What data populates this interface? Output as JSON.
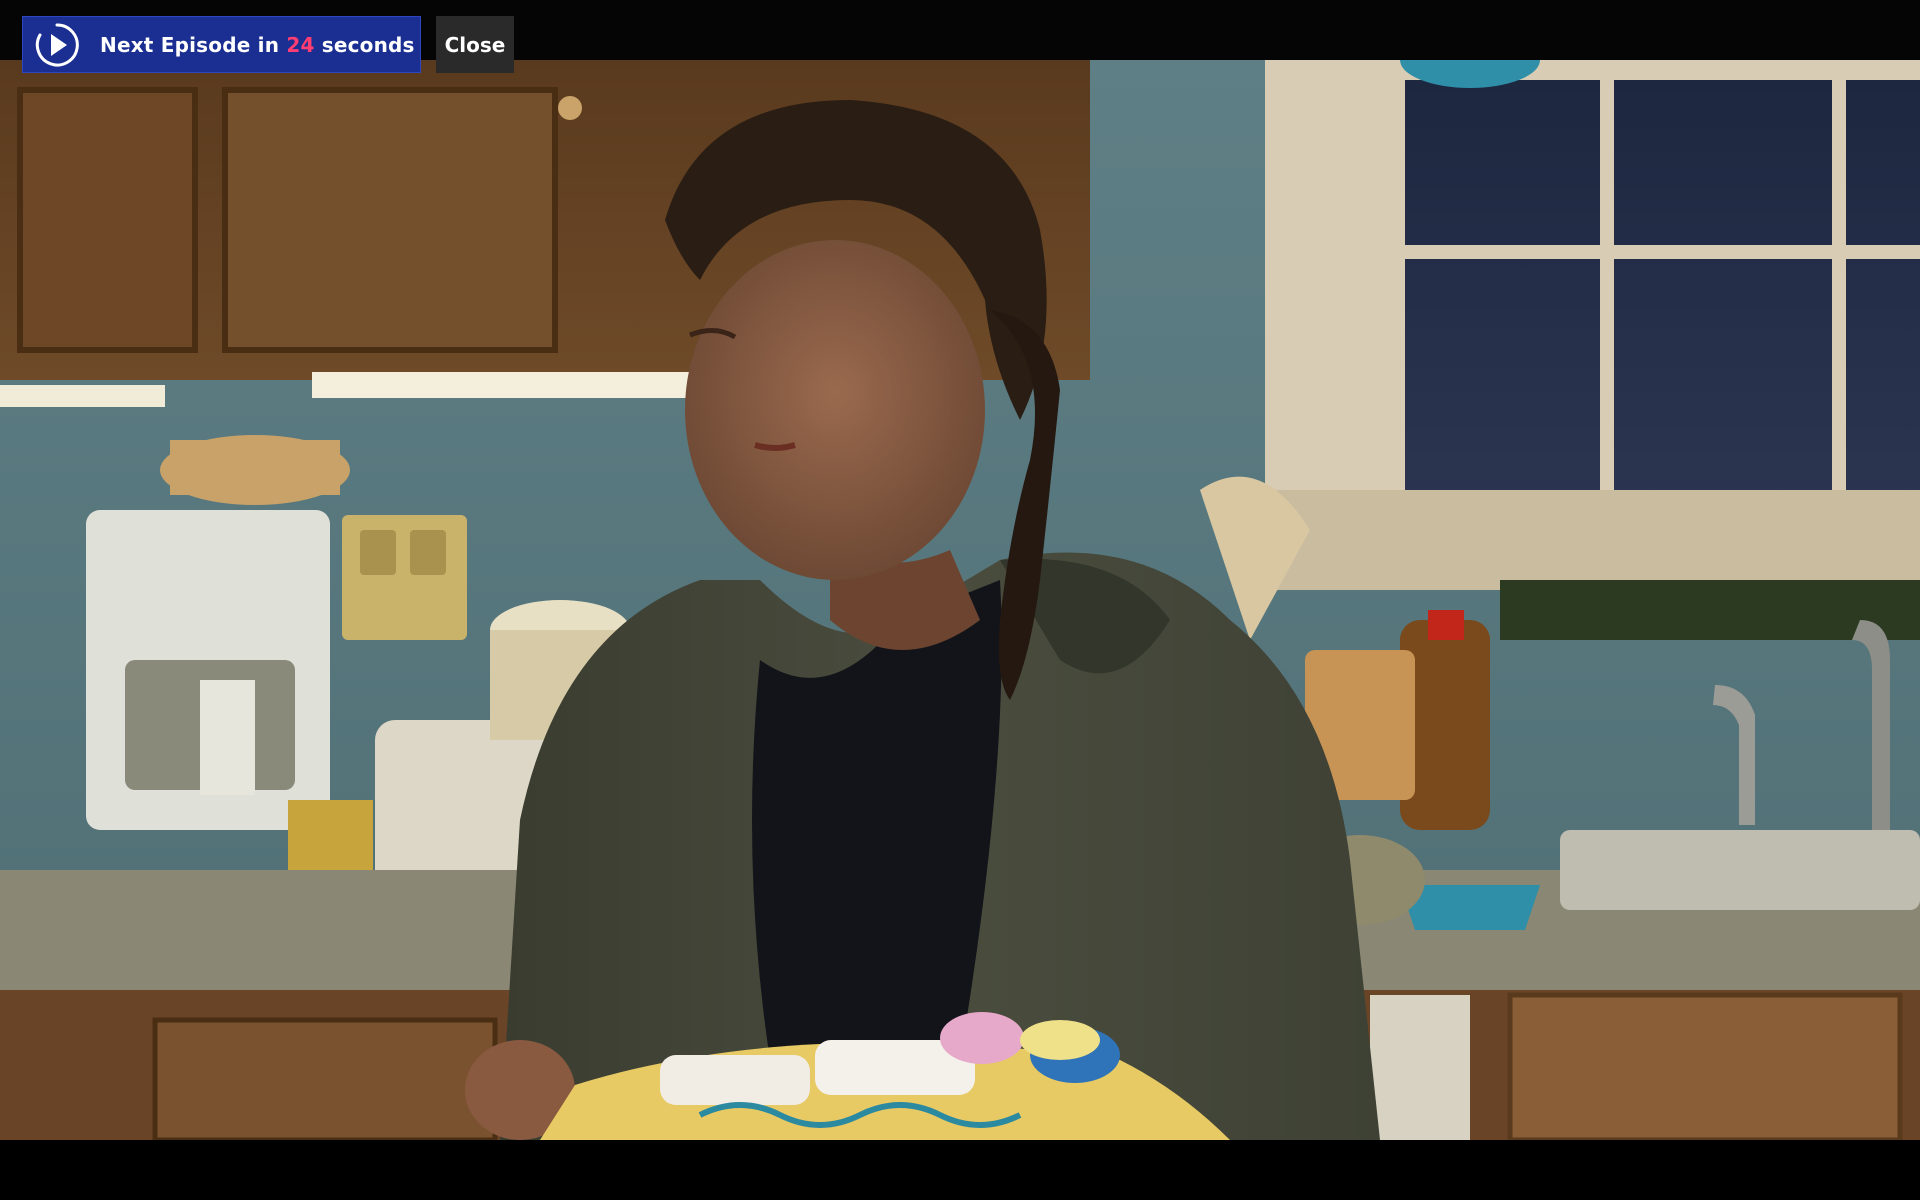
{
  "overlay": {
    "next_episode": {
      "prefix": "Next Episode in",
      "countdown": "24",
      "suffix": "seconds",
      "icon": "play-circle-icon",
      "background": "#1b2f92",
      "countdown_color": "#ff3d72"
    },
    "close_label": "Close"
  },
  "video": {
    "scene": "video-frame"
  }
}
